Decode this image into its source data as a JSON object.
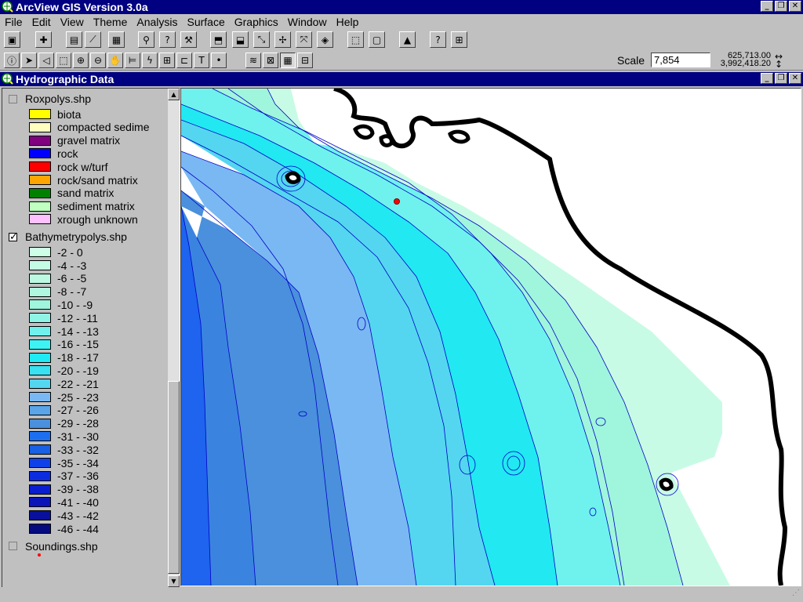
{
  "app": {
    "title": "ArcView GIS Version 3.0a",
    "window_buttons": [
      "_",
      "❐",
      "✕"
    ]
  },
  "menu": [
    "File",
    "Edit",
    "View",
    "Theme",
    "Analysis",
    "Surface",
    "Graphics",
    "Window",
    "Help"
  ],
  "scale": {
    "label": "Scale",
    "value": "7,854",
    "x_coord": "625,713.00",
    "y_coord": "3,992,418.20"
  },
  "view": {
    "title": "Hydrographic Data"
  },
  "themes": [
    {
      "name": "Roxpolys.shp",
      "checked": false,
      "classes": [
        {
          "label": "biota",
          "color": "#ffff00"
        },
        {
          "label": "compacted sedime",
          "color": "#ffffc0"
        },
        {
          "label": "gravel matrix",
          "color": "#800080"
        },
        {
          "label": "rock",
          "color": "#0000ff"
        },
        {
          "label": "rock w/turf",
          "color": "#ff0000"
        },
        {
          "label": "rock/sand matrix",
          "color": "#ffa500"
        },
        {
          "label": "sand matrix",
          "color": "#008000"
        },
        {
          "label": "sediment matrix",
          "color": "#c0ffc0"
        },
        {
          "label": "xrough unknown",
          "color": "#ffc0ff"
        }
      ]
    },
    {
      "name": "Bathymetrypolys.shp",
      "checked": true,
      "classes": [
        {
          "label": "-2 - 0",
          "color": "#ccffe6"
        },
        {
          "label": "-4 - -3",
          "color": "#c4fbe4"
        },
        {
          "label": "-6 - -5",
          "color": "#bcf9e2"
        },
        {
          "label": "-8 - -7",
          "color": "#b0f7e0"
        },
        {
          "label": "-10 - -9",
          "color": "#a0f5dd"
        },
        {
          "label": "-12 - -11",
          "color": "#8ff3e6"
        },
        {
          "label": "-14 - -13",
          "color": "#6ff2ee"
        },
        {
          "label": "-16 - -15",
          "color": "#3ff3f5"
        },
        {
          "label": "-18 - -17",
          "color": "#1feaf5"
        },
        {
          "label": "-20 - -19",
          "color": "#38e2f0"
        },
        {
          "label": "-22 - -21",
          "color": "#54d6f0"
        },
        {
          "label": "-25 - -23",
          "color": "#7ab8f3"
        },
        {
          "label": "-27 - -26",
          "color": "#5aa4e8"
        },
        {
          "label": "-29 - -28",
          "color": "#4a90dc"
        },
        {
          "label": "-31 - -30",
          "color": "#1e6ff0"
        },
        {
          "label": "-33 - -32",
          "color": "#1860e4"
        },
        {
          "label": "-35 - -34",
          "color": "#1040e8"
        },
        {
          "label": "-37 - -36",
          "color": "#0c2ce0"
        },
        {
          "label": "-39 - -38",
          "color": "#0a1ed0"
        },
        {
          "label": "-41 - -40",
          "color": "#0a14b8"
        },
        {
          "label": "-43 - -42",
          "color": "#08109c"
        },
        {
          "label": "-46 - -44",
          "color": "#060a80"
        }
      ]
    },
    {
      "name": "Soundings.shp",
      "checked": false,
      "symbol_color": "#ff0000"
    }
  ],
  "toolbar1": [
    "save-icon",
    "add-theme-icon",
    "theme-properties-icon",
    "edit-legend-icon",
    "open-table-icon",
    "find-icon",
    "query-builder-icon",
    "locate-address-icon",
    "zoom-full-icon",
    "zoom-active-icon",
    "zoom-selected-icon",
    "zoom-in-fixed-icon",
    "zoom-out-fixed-icon",
    "zoom-previous-icon",
    "select-by-theme-icon",
    "clear-selected-icon",
    "help-icon",
    "hotlink-icon",
    "layout-icon"
  ],
  "toolbar2": [
    "identify-icon",
    "pointer-icon",
    "vertex-edit-icon",
    "select-feature-icon",
    "zoom-in-icon",
    "zoom-out-icon",
    "pan-icon",
    "measure-icon",
    "hotlink-tool-icon",
    "area-of-interest-icon",
    "text-tool-icon",
    "draw-point-icon",
    "contour-tool-icon",
    "grid-tool-icon",
    "query-tool-icon",
    "table-tool-icon"
  ],
  "colors": {
    "titlebar": "#000080",
    "chrome": "#c0c0c0",
    "coastline": "#000000",
    "contour": "#0000c8"
  }
}
